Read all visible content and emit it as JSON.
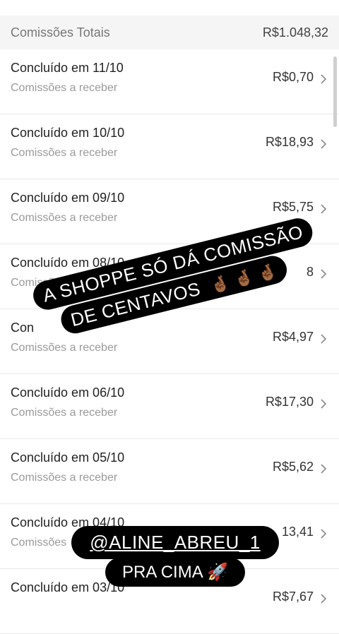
{
  "header": {
    "totals_label": "Comissões Totais",
    "totals_value": "R$1.048,32"
  },
  "rows": [
    {
      "title": "Concluído em 11/10",
      "sub": "Comissões a receber",
      "amount": "R$0,70"
    },
    {
      "title": "Concluído em 10/10",
      "sub": "Comissões a receber",
      "amount": "R$18,93"
    },
    {
      "title": "Concluído em 09/10",
      "sub": "Comissões a receber",
      "amount": "R$5,75"
    },
    {
      "title": "Concluído em 08/10",
      "sub": "Comissões a receber",
      "amount": "8"
    },
    {
      "title": "Con",
      "sub": "Comissões a receber",
      "amount": "R$4,97"
    },
    {
      "title": "Concluído em 06/10",
      "sub": "Comissões a receber",
      "amount": "R$17,30"
    },
    {
      "title": "Concluído em 05/10",
      "sub": "Comissões a receber",
      "amount": "R$5,62"
    },
    {
      "title": "Concluído em 04/10",
      "sub": "Comissões",
      "amount": "13,41"
    },
    {
      "title": "Concluído em 03/10",
      "sub": "",
      "amount": "R$7,67"
    }
  ],
  "overlay_text": {
    "line1": "A SHOPPE SÓ  DÁ COMISSÃO",
    "line2": "DE  CENTAVOS",
    "emojis": "🤞🏾 🤞🏾 🤞🏾"
  },
  "sticker": {
    "handle": "@ALINE_ABREU_1",
    "cta": "PRA CIMA",
    "cta_emoji": "🚀"
  },
  "icons": {
    "chevron": "chevron-right-icon"
  },
  "colors": {
    "background": "#ffffff",
    "totals_bg": "#f5f5f5",
    "overlay_bg": "#000000",
    "overlay_text": "#ffffff"
  }
}
